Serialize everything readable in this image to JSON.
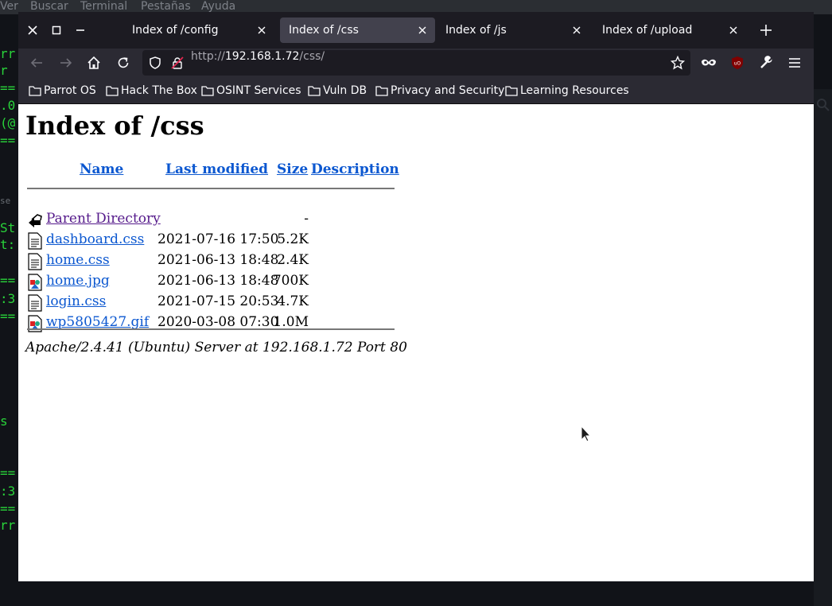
{
  "terminal": {
    "menu": [
      "Ver",
      "Buscar",
      "Terminal",
      "Pestañas",
      "Ayuda"
    ],
    "fragments": [
      "rr",
      "r",
      "==",
      ".0",
      "(@",
      "==",
      "se",
      "St",
      "t:",
      "==",
      ":3",
      "==",
      "s",
      "==",
      ":3",
      "==",
      "rr"
    ]
  },
  "browser": {
    "tabs": [
      {
        "title": "Index of /config",
        "active": false
      },
      {
        "title": "Index of /css",
        "active": true
      },
      {
        "title": "Index of /js",
        "active": false
      },
      {
        "title": "Index of /upload",
        "active": false
      }
    ],
    "url_prefix": "http://",
    "url_host": "192.168.1.72",
    "url_path": "/css/",
    "bookmarks": [
      "Parrot OS",
      "Hack The Box",
      "OSINT Services",
      "Vuln DB",
      "Privacy and Security",
      "Learning Resources"
    ]
  },
  "page": {
    "title": "Index of /css",
    "columns": {
      "name": "Name",
      "modified": "Last modified",
      "size": "Size",
      "description": "Description"
    },
    "rows": [
      {
        "name": "Parent Directory",
        "modified": "",
        "size": "-",
        "icon": "back-icon"
      },
      {
        "name": "dashboard.css",
        "modified": "2021-07-16 17:50",
        "size": "5.2K",
        "icon": "text-file-icon"
      },
      {
        "name": "home.css",
        "modified": "2021-06-13 18:48",
        "size": "2.4K",
        "icon": "text-file-icon"
      },
      {
        "name": "home.jpg",
        "modified": "2021-06-13 18:48",
        "size": "700K",
        "icon": "image-file-icon"
      },
      {
        "name": "login.css",
        "modified": "2021-07-15 20:53",
        "size": "4.7K",
        "icon": "text-file-icon"
      },
      {
        "name": "wp5805427.gif",
        "modified": "2020-03-08 07:30",
        "size": "1.0M",
        "icon": "image-file-icon"
      }
    ],
    "address": "Apache/2.4.41 (Ubuntu) Server at 192.168.1.72 Port 80"
  }
}
